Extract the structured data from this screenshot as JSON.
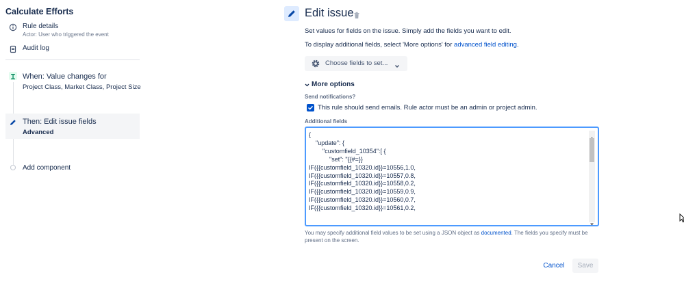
{
  "sidebar": {
    "title": "Calculate Efforts",
    "rule_details": {
      "label": "Rule details",
      "sub": "Actor: User who triggered the event",
      "icon": "info-icon"
    },
    "audit_log": {
      "label": "Audit log",
      "icon": "document-icon"
    },
    "trigger": {
      "label": "When: Value changes for",
      "sub": "Project Class, Market Class, Project Size",
      "icon": "trigger-icon"
    },
    "action": {
      "label": "Then: Edit issue fields",
      "sub": "Advanced",
      "icon": "pencil-icon"
    },
    "add_component": {
      "label": "Add component"
    }
  },
  "main": {
    "title": "Edit issue",
    "description": "Set values for fields on the issue. Simply add the fields you want to edit.",
    "more_fields_prefix": "To display additional fields, select 'More options' for ",
    "more_fields_link": "advanced field editing",
    "more_fields_suffix": ".",
    "choose_fields_label": "Choose fields to set...",
    "more_options_label": "More options",
    "send_notifications_label": "Send notifications?",
    "send_notifications_text": "This rule should send emails. Rule actor must be an admin or project admin.",
    "send_notifications_checked": true,
    "additional_fields_label": "Additional fields",
    "additional_fields_lines": [
      "{",
      "    \"update\": {",
      "        \"customfield_10354\":[ {",
      "            \"set\": \"{{#=}}",
      "IF({{customfield_10320.id}}=10556,1.0,",
      "IF({{customfield_10320.id}}=10557,0.8,",
      "IF({{customfield_10320.id}}=10558,0.2,",
      "IF({{customfield_10320.id}}=10559,0.9,",
      "IF({{customfield_10320.id}}=10560,0.7,",
      "IF({{customfield_10320.id}}=10561,0.2,"
    ],
    "help_prefix": "You may specify additional field values to be set using a JSON object as ",
    "help_link": "documented",
    "help_suffix": ". The fields you specify must be",
    "help_line2": "present on the screen.",
    "cancel_label": "Cancel",
    "save_label": "Save"
  },
  "colors": {
    "accent": "#0052cc",
    "focus_border": "#4c9aff",
    "selected_bg": "#f4f5f7",
    "trigger_bg": "#e3fcef",
    "edit_icon_bg": "#deebff"
  }
}
